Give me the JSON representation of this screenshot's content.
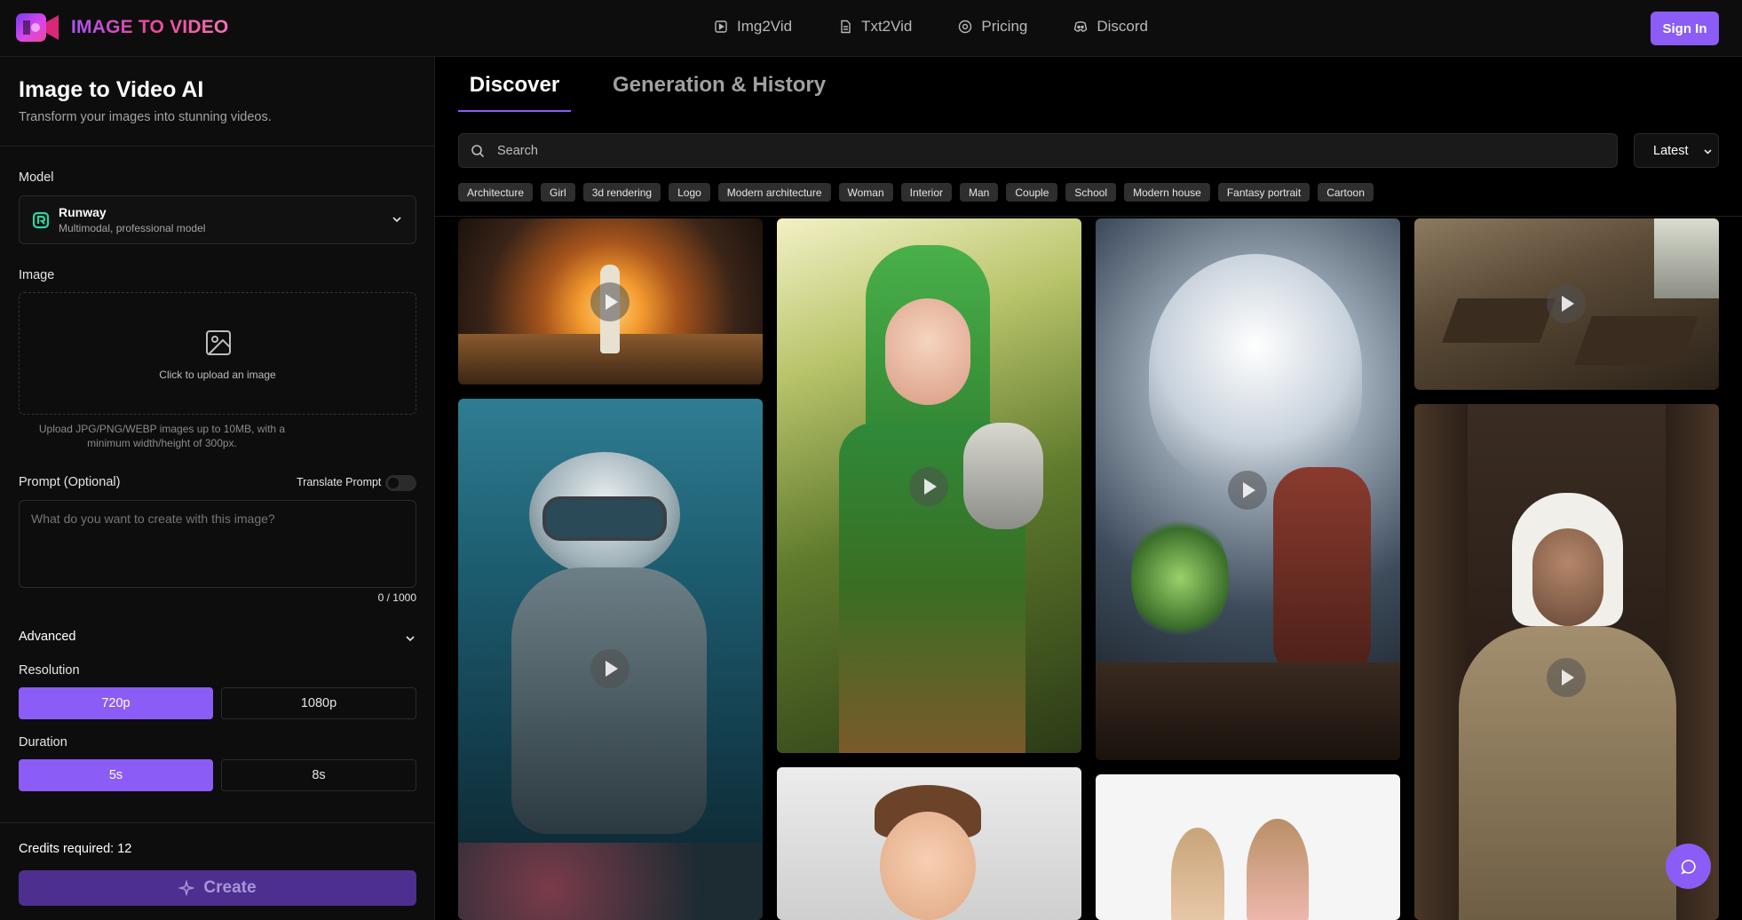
{
  "header": {
    "logo_text": "IMAGE TO VIDEO",
    "nav": [
      {
        "label": "Img2Vid",
        "icon": "video-file-icon"
      },
      {
        "label": "Txt2Vid",
        "icon": "document-icon"
      },
      {
        "label": "Pricing",
        "icon": "coin-icon"
      },
      {
        "label": "Discord",
        "icon": "discord-icon"
      }
    ],
    "signin_label": "Sign In"
  },
  "left": {
    "title": "Image to Video AI",
    "subtitle": "Transform your images into stunning videos.",
    "model_label": "Model",
    "model_name": "Runway",
    "model_desc": "Multimodal, professional model",
    "image_label": "Image",
    "upload_text": "Click to upload an image",
    "upload_note": "Upload JPG/PNG/WEBP images up to 10MB, with a minimum width/height of 300px.",
    "prompt_label": "Prompt (Optional)",
    "translate_label": "Translate Prompt",
    "prompt_placeholder": "What do you want to create with this image?",
    "counter": "0 / 1000",
    "advanced_label": "Advanced",
    "resolution_label": "Resolution",
    "resolution_options": [
      "720p",
      "1080p"
    ],
    "duration_label": "Duration",
    "duration_options": [
      "5s",
      "8s"
    ],
    "credits": "Credits required: 12",
    "create_label": "Create"
  },
  "main": {
    "tabs": [
      "Discover",
      "Generation & History"
    ],
    "search_placeholder": "Search",
    "sort_value": "Latest",
    "chips": [
      "Architecture",
      "Girl",
      "3d rendering",
      "Logo",
      "Modern architecture",
      "Woman",
      "Interior",
      "Man",
      "Couple",
      "School",
      "Modern house",
      "Fantasy portrait",
      "Cartoon"
    ]
  },
  "colors": {
    "accent": "#8b5cf6",
    "background": "#000000",
    "panel": "#0d0d0d"
  }
}
